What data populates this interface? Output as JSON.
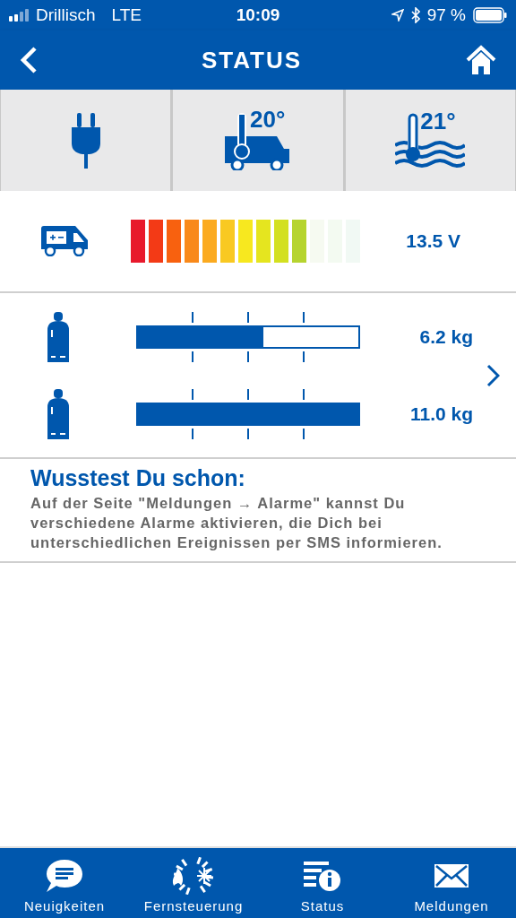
{
  "status_bar": {
    "carrier": "Drillisch",
    "network": "LTE",
    "time": "10:09",
    "battery": "97 %"
  },
  "nav": {
    "title": "STATUS"
  },
  "tiles": [
    {
      "kind": "power"
    },
    {
      "kind": "interior",
      "reading": "20°"
    },
    {
      "kind": "water",
      "reading": "21°"
    }
  ],
  "battery": {
    "level": 0.77,
    "reading": "13.5 V"
  },
  "gas_bottles": [
    {
      "level": 0.57,
      "reading": "6.2 kg"
    },
    {
      "level": 1.0,
      "reading": "11.0 kg"
    }
  ],
  "tip": {
    "title": "Wusstest Du schon:",
    "text": "Auf der Seite \"Meldungen → Alarme\" kannst Du verschiedene Alarme aktivieren, die Dich bei unterschiedlichen Ereignissen per SMS informieren."
  },
  "tab_bar": [
    {
      "kind": "news",
      "label": "Neuigkeiten"
    },
    {
      "kind": "remote",
      "label": "Fernsteuerung"
    },
    {
      "kind": "status",
      "label": "Status"
    },
    {
      "kind": "messages",
      "label": "Meldungen"
    }
  ]
}
